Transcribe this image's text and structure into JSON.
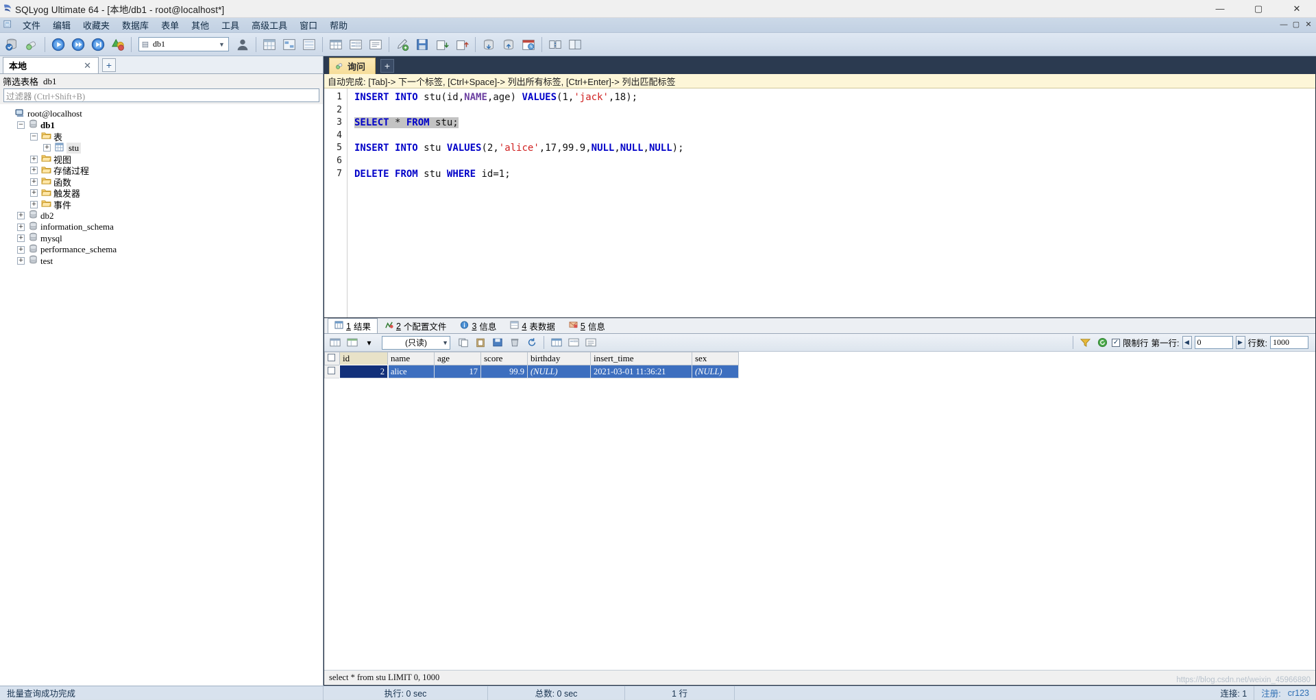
{
  "window": {
    "title": "SQLyog Ultimate 64 - [本地/db1 - root@localhost*]",
    "app_icon": "sqlyog-icon",
    "minimize": "—",
    "maximize": "▢",
    "close": "✕",
    "mdi_minimize": "—",
    "mdi_restore": "▢",
    "mdi_close": "✕"
  },
  "menu": {
    "items": [
      {
        "label": "文件"
      },
      {
        "label": "编辑"
      },
      {
        "label": "收藏夹"
      },
      {
        "label": "数据库"
      },
      {
        "label": "表单"
      },
      {
        "label": "其他"
      },
      {
        "label": "工具"
      },
      {
        "label": "高级工具"
      },
      {
        "label": "窗口"
      },
      {
        "label": "帮助"
      }
    ]
  },
  "toolbar": {
    "buttons": [
      {
        "name": "new-connection-icon",
        "glyph": "🗄"
      },
      {
        "name": "refresh-object-icon",
        "glyph": "🔖"
      },
      {
        "name": "execute-query-icon",
        "glyph": "▶"
      },
      {
        "name": "execute-all-queries-icon",
        "glyph": "⏩"
      },
      {
        "name": "execute-current-query-icon",
        "glyph": "▷"
      },
      {
        "name": "stop-query-icon",
        "glyph": "🔺"
      },
      {
        "name": "user-manager-icon",
        "glyph": "👤"
      },
      {
        "name": "table-diagnostics-icon",
        "glyph": "▤"
      },
      {
        "name": "query-builder-icon",
        "glyph": "▦"
      },
      {
        "name": "schema-designer-icon",
        "glyph": "▥"
      },
      {
        "name": "grid-view-icon",
        "glyph": "▦"
      },
      {
        "name": "form-view-icon",
        "glyph": "▣"
      },
      {
        "name": "text-view-icon",
        "glyph": "▤"
      },
      {
        "name": "new-query-tab-icon",
        "glyph": "✎"
      },
      {
        "name": "save-query-icon",
        "glyph": "💾"
      },
      {
        "name": "import-external-data-icon",
        "glyph": "📥"
      },
      {
        "name": "export-data-icon",
        "glyph": "📤"
      },
      {
        "name": "backup-database-icon",
        "glyph": "📦"
      },
      {
        "name": "restore-database-icon",
        "glyph": "🗃"
      },
      {
        "name": "scheduler-icon",
        "glyph": "🗓"
      },
      {
        "name": "sync-data-icon",
        "glyph": "🔁"
      }
    ],
    "database_combo": {
      "value": "db1",
      "icon": "database-icon",
      "arrow": "▼"
    }
  },
  "left_panel": {
    "tab": {
      "label": "本地",
      "close": "✕"
    },
    "add_tab": "+",
    "filter_label": "筛选表格",
    "filter_db": "db1",
    "filter_placeholder": "过滤器 (Ctrl+Shift+B)",
    "tree": [
      {
        "depth": 0,
        "expander": "",
        "icon": "host-icon",
        "label": "root@localhost",
        "style": "mono"
      },
      {
        "depth": 1,
        "expander": "−",
        "icon": "database-icon",
        "label": "db1",
        "style": "mono-bold"
      },
      {
        "depth": 2,
        "expander": "−",
        "icon": "folder-icon",
        "label": "表",
        "style": "cn"
      },
      {
        "depth": 3,
        "expander": "+",
        "icon": "table-icon",
        "label": "stu",
        "style": "mono-sel"
      },
      {
        "depth": 2,
        "expander": "+",
        "icon": "folder-icon",
        "label": "视图",
        "style": "cn"
      },
      {
        "depth": 2,
        "expander": "+",
        "icon": "folder-icon",
        "label": "存储过程",
        "style": "cn"
      },
      {
        "depth": 2,
        "expander": "+",
        "icon": "folder-icon",
        "label": "函数",
        "style": "cn"
      },
      {
        "depth": 2,
        "expander": "+",
        "icon": "folder-icon",
        "label": "触发器",
        "style": "cn"
      },
      {
        "depth": 2,
        "expander": "+",
        "icon": "folder-icon",
        "label": "事件",
        "style": "cn"
      },
      {
        "depth": 1,
        "expander": "+",
        "icon": "database-icon",
        "label": "db2",
        "style": "mono"
      },
      {
        "depth": 1,
        "expander": "+",
        "icon": "database-icon",
        "label": "information_schema",
        "style": "mono"
      },
      {
        "depth": 1,
        "expander": "+",
        "icon": "database-icon",
        "label": "mysql",
        "style": "mono"
      },
      {
        "depth": 1,
        "expander": "+",
        "icon": "database-icon",
        "label": "performance_schema",
        "style": "mono"
      },
      {
        "depth": 1,
        "expander": "+",
        "icon": "database-icon",
        "label": "test",
        "style": "mono"
      }
    ]
  },
  "query": {
    "tab": {
      "label": "询问",
      "icon": "query-icon"
    },
    "add_tab": "+",
    "hint": "自动完成: [Tab]-> 下一个标签, [Ctrl+Space]-> 列出所有标签, [Ctrl+Enter]-> 列出匹配标签",
    "line_numbers": [
      "1",
      "2",
      "3",
      "4",
      "5",
      "6",
      "7"
    ],
    "lines": [
      {
        "n": 1,
        "selected": false,
        "tokens": [
          {
            "t": "INSERT",
            "c": "kw"
          },
          {
            "t": " ",
            "c": "plain"
          },
          {
            "t": "INTO",
            "c": "kw"
          },
          {
            "t": " stu(id,",
            "c": "plain"
          },
          {
            "t": "NAME",
            "c": "kw2"
          },
          {
            "t": ",age) ",
            "c": "plain"
          },
          {
            "t": "VALUES",
            "c": "kw"
          },
          {
            "t": "(1,",
            "c": "plain"
          },
          {
            "t": "'jack'",
            "c": "str"
          },
          {
            "t": ",18);",
            "c": "plain"
          }
        ]
      },
      {
        "n": 2,
        "selected": false,
        "tokens": []
      },
      {
        "n": 3,
        "selected": true,
        "tokens": [
          {
            "t": "SELECT",
            "c": "kw"
          },
          {
            "t": " * ",
            "c": "plain"
          },
          {
            "t": "FROM",
            "c": "kw"
          },
          {
            "t": " stu;",
            "c": "plain"
          }
        ]
      },
      {
        "n": 4,
        "selected": false,
        "tokens": []
      },
      {
        "n": 5,
        "selected": false,
        "tokens": [
          {
            "t": "INSERT",
            "c": "kw"
          },
          {
            "t": " ",
            "c": "plain"
          },
          {
            "t": "INTO",
            "c": "kw"
          },
          {
            "t": " stu ",
            "c": "plain"
          },
          {
            "t": "VALUES",
            "c": "kw"
          },
          {
            "t": "(2,",
            "c": "plain"
          },
          {
            "t": "'alice'",
            "c": "str"
          },
          {
            "t": ",17,99.9,",
            "c": "plain"
          },
          {
            "t": "NULL",
            "c": "kw"
          },
          {
            "t": ",",
            "c": "plain"
          },
          {
            "t": "NULL",
            "c": "kw"
          },
          {
            "t": ",",
            "c": "plain"
          },
          {
            "t": "NULL",
            "c": "kw"
          },
          {
            "t": ");",
            "c": "plain"
          }
        ]
      },
      {
        "n": 6,
        "selected": false,
        "tokens": []
      },
      {
        "n": 7,
        "selected": false,
        "tokens": [
          {
            "t": "DELETE",
            "c": "kw"
          },
          {
            "t": " ",
            "c": "plain"
          },
          {
            "t": "FROM",
            "c": "kw"
          },
          {
            "t": " stu ",
            "c": "plain"
          },
          {
            "t": "WHERE",
            "c": "kw"
          },
          {
            "t": " id=1;",
            "c": "plain"
          }
        ]
      }
    ]
  },
  "results": {
    "tabs": [
      {
        "num": "1",
        "label": "结果",
        "icon": "grid-icon",
        "active": true
      },
      {
        "num": "2",
        "label": "个配置文件",
        "icon": "profile-icon",
        "active": false
      },
      {
        "num": "3",
        "label": "信息",
        "icon": "info-icon",
        "active": false
      },
      {
        "num": "4",
        "label": "表数据",
        "icon": "table-icon",
        "active": false
      },
      {
        "num": "5",
        "label": "信息",
        "icon": "message-icon",
        "active": false
      }
    ],
    "toolbar": {
      "buttons": [
        {
          "name": "grid-refresh-icon",
          "glyph": "▦"
        },
        {
          "name": "grid-new-icon",
          "glyph": "▤"
        },
        {
          "name": "grid-dropdown-icon",
          "glyph": "▾"
        },
        {
          "name": "copy-row-icon",
          "glyph": "⧉"
        },
        {
          "name": "paste-row-icon",
          "glyph": "📋"
        },
        {
          "name": "save-changes-icon",
          "glyph": "💾"
        },
        {
          "name": "delete-row-icon",
          "glyph": "🗑"
        },
        {
          "name": "refresh-data-icon",
          "glyph": "🔄"
        },
        {
          "name": "grid-view-icon",
          "glyph": "▦"
        },
        {
          "name": "form-view-icon",
          "glyph": "▤"
        },
        {
          "name": "text-view-icon",
          "glyph": "▤"
        }
      ],
      "mode_combo": {
        "value": "(只读)",
        "arrow": "▼"
      },
      "filter_icon": "filter-icon",
      "refresh_icon": "refresh-circle-icon",
      "limit_checkbox": {
        "checked": true,
        "mark": "✓",
        "label": "限制行"
      },
      "first_row_label": "第一行:",
      "first_row_value": "0",
      "row_count_label": "行数:",
      "row_count_value": "1000",
      "prev_arrow": "◀",
      "next_arrow": "▶"
    },
    "grid": {
      "columns": [
        "id",
        "name",
        "age",
        "score",
        "birthday",
        "insert_time",
        "sex"
      ],
      "rows": [
        {
          "selected": true,
          "cells": [
            {
              "v": "2",
              "align": "right",
              "focus": true
            },
            {
              "v": "alice",
              "align": "left"
            },
            {
              "v": "17",
              "align": "right"
            },
            {
              "v": "99.9",
              "align": "right"
            },
            {
              "v": "(NULL)",
              "align": "left",
              "null": true
            },
            {
              "v": "2021-03-01 11:36:21",
              "align": "left"
            },
            {
              "v": "(NULL)",
              "align": "left",
              "null": true
            }
          ]
        }
      ]
    },
    "executed_sql": "select * from stu LIMIT 0, 1000"
  },
  "statusbar": {
    "message": "批量查询成功完成",
    "exec_time": "执行: 0 sec",
    "total_time": "总数: 0 sec",
    "rows": "1 行",
    "connections_label": "连接: 1",
    "user_label": "注册:",
    "user_value": "cr123"
  },
  "watermark": {
    "top": "https://blog.csdn.net/weixin_45966880"
  }
}
